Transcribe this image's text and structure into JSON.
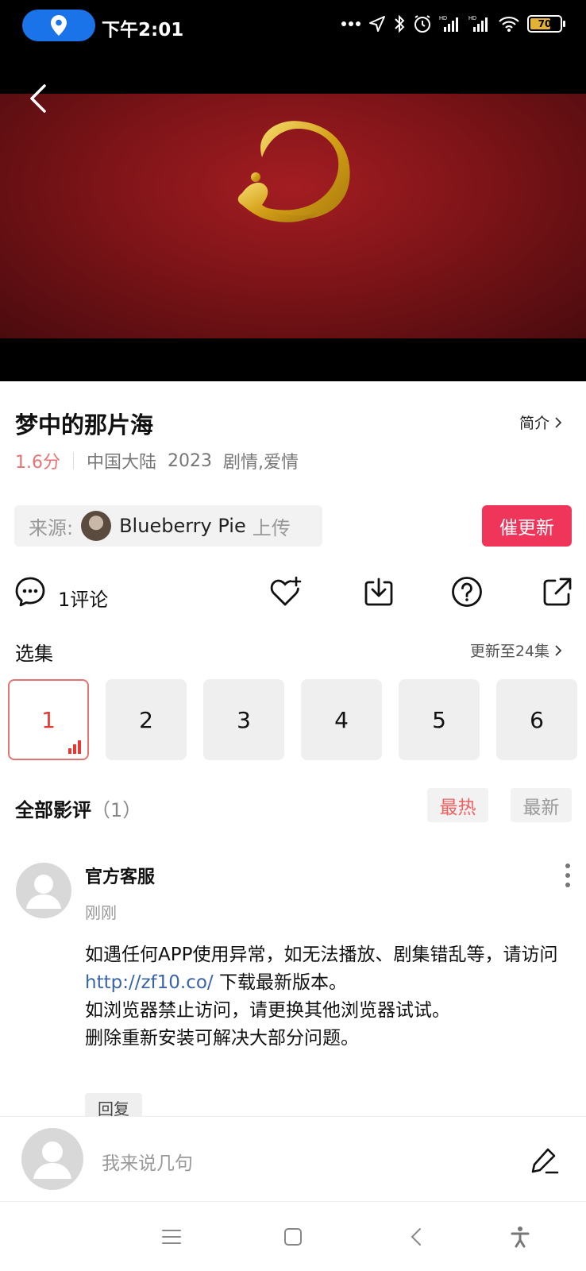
{
  "status_bar": {
    "time": "下午2:01",
    "battery": "70",
    "icons": [
      "location-pin-icon",
      "more-dots-icon",
      "navigation-icon",
      "bluetooth-icon",
      "alarm-icon",
      "signal-hd-icon",
      "signal-hd-icon",
      "wifi-icon",
      "battery-icon"
    ]
  },
  "video": {
    "back_icon": "back-arrow-icon"
  },
  "show": {
    "title": "梦中的那片海",
    "intro_label": "简介",
    "score": "1.6分",
    "region": "中国大陆",
    "year": "2023",
    "genre": "剧情,爱情"
  },
  "source": {
    "label": "来源:",
    "uploader": "Blueberry Pie",
    "upload_suffix": "上传",
    "urge_label": "催更新"
  },
  "actions": {
    "comment_count_label": "1评论",
    "icons": [
      "comment-icon",
      "favorite-add-icon",
      "download-icon",
      "help-icon",
      "share-icon"
    ]
  },
  "episodes": {
    "header": "选集",
    "update_label": "更新至24集",
    "items": [
      "1",
      "2",
      "3",
      "4",
      "5",
      "6"
    ],
    "active": "1"
  },
  "reviews": {
    "title": "全部影评",
    "count": "（1）",
    "sort_hot": "最热",
    "sort_new": "最新",
    "items": [
      {
        "user": "官方客服",
        "time": "刚刚",
        "line1": "如遇任何APP使用异常，如无法播放、剧集错乱等，请访问",
        "link": "http://zf10.co/",
        "line2": " 下载最新版本。",
        "line3": "如浏览器禁止访问，请更换其他浏览器试试。",
        "line4": "删除重新安装可解决大部分问题。",
        "reply_label": "回复"
      }
    ]
  },
  "input_bar": {
    "placeholder": "我来说几句"
  },
  "nav_bar": {
    "icons": [
      "menu-icon",
      "home-icon",
      "back-icon",
      "accessibility-icon"
    ]
  }
}
